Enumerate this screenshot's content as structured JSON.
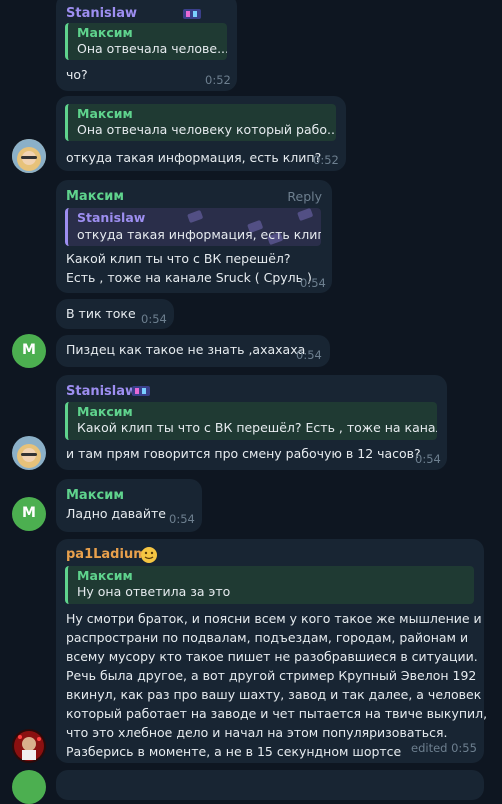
{
  "colors": {
    "background": "#0e1621",
    "bubble": "#182533",
    "green_name": "#5fd38d",
    "purple_name": "#9d8ef0",
    "orange_name": "#e8a04c"
  },
  "messages": [
    {
      "sender": "Stanislaw",
      "reply": {
        "name": "Максим",
        "text": "Она отвечала челове..."
      },
      "text": "чо?",
      "time": "0:52"
    },
    {
      "reply": {
        "name": "Максим",
        "text": "Она отвечала человеку который рабо..."
      },
      "text": "откуда такая информация, есть клип?",
      "time": "0:52"
    },
    {
      "sender": "Максим",
      "action": "Reply",
      "reply": {
        "name": "Stanislaw",
        "text": "откуда такая информация, есть клип?"
      },
      "lines": [
        "Какой  клип ты что с ВК перешёл?",
        "Есть , тоже на канале Sruck ( Сруль )"
      ],
      "time": "0:54"
    },
    {
      "text": "В тик токе",
      "time": "0:54"
    },
    {
      "avatar_letter": "M",
      "text": "Пиздец как такое не знать ,ахахаха",
      "time": "0:54"
    },
    {
      "sender": "Stanislaw",
      "reply": {
        "name": "Максим",
        "text": "Какой  клип ты что с ВК перешёл?  Есть , тоже на канал..."
      },
      "text": "и там прям говорится про смену рабочую в 12 часов?",
      "time": "0:54"
    },
    {
      "sender": "Максим",
      "avatar_letter": "M",
      "text": "Ладно давайте",
      "time": "0:54"
    },
    {
      "sender": "pa1Ladium",
      "reply": {
        "name": "Максим",
        "text": "Ну она ответила за это"
      },
      "lines": [
        "Ну смотри браток, и поясни всем у кого такое же мышление и",
        "распространи по подвалам, подъездам, городам, районам и",
        "всему мусору кто такое пишет  не разобравшиеся в ситуации.",
        "Речь была другое, а вот другой стример Крупный Эвелон 192",
        "вкинул, как раз про вашу шахту, завод и так далее, а человек",
        "который работает на заводе и чет пытается на твиче выкупил,",
        "что это хлебное дело и начал на этом популяризоваться.",
        "Разберись в моменте, а не в 15 секундном шортсе"
      ],
      "time": "edited 0:55"
    }
  ]
}
